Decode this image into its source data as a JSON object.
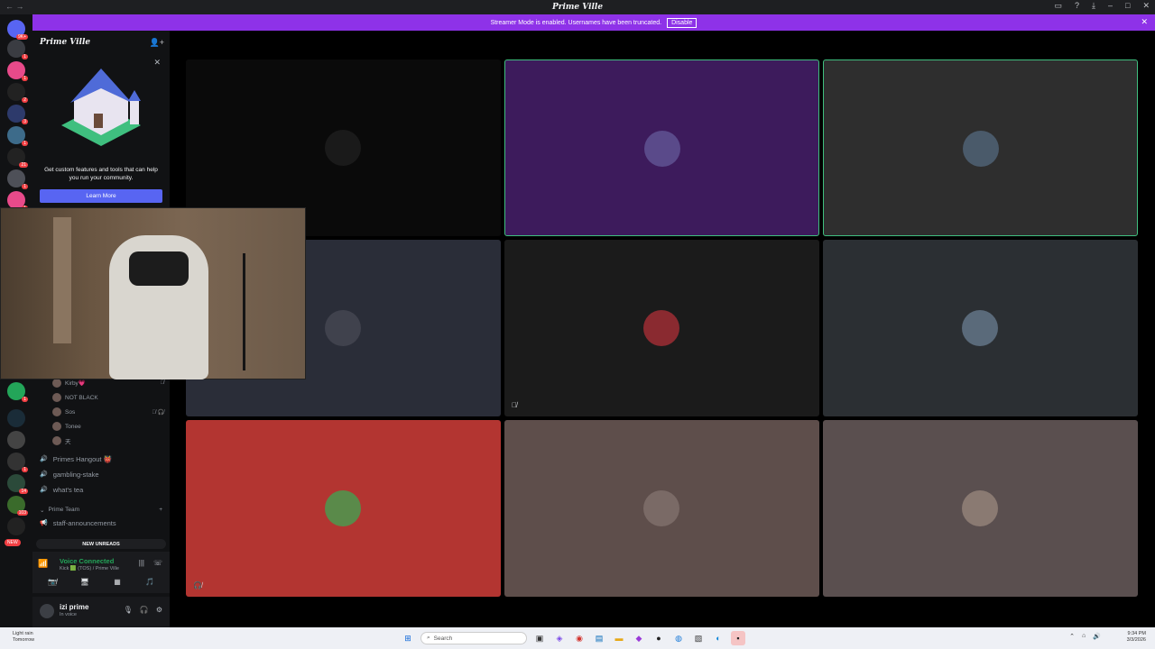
{
  "window": {
    "title": "Prime Ville",
    "nav": "← →"
  },
  "banner": {
    "message": "Streamer Mode is enabled. Usernames have been truncated.",
    "disable_label": "Disable"
  },
  "rail": {
    "badges": [
      "9K+",
      "1",
      "1",
      "2",
      "3",
      "1",
      "21",
      "1",
      "1",
      "1",
      "1",
      "14",
      "103"
    ],
    "new_label": "NEW"
  },
  "sidebar": {
    "server_name": "Prime Ville",
    "promo_text": "Get custom features and tools that can help you run your community.",
    "learn_more": "Learn More",
    "voice_users": [
      {
        "name": "Kirby💗"
      },
      {
        "name": "NOT BLACK"
      },
      {
        "name": "Sos"
      },
      {
        "name": "Tonee"
      },
      {
        "name": "天"
      }
    ],
    "channels": [
      {
        "name": "Primes Hangout 👹"
      },
      {
        "name": "gambling-stake"
      },
      {
        "name": "what's tea"
      }
    ],
    "category": {
      "name": "Prime Team",
      "plus": "+"
    },
    "staff_channel": "staff-announcements",
    "new_unreads": "NEW UNREADS"
  },
  "voice_panel": {
    "status": "Voice Connected",
    "channel": "Kick 🟩 (TOS) / Prime Ville"
  },
  "user_panel": {
    "name": "izi prime",
    "status": "In voice"
  },
  "taskbar": {
    "weather_line1": "Light rain",
    "weather_line2": "Tomorrow",
    "search_placeholder": "Search",
    "time": "9:34 PM",
    "date": "3/3/2026"
  },
  "colors": {
    "accent": "#5865f2",
    "streamer_banner": "#8e32e8",
    "voice_green": "#23a559"
  }
}
